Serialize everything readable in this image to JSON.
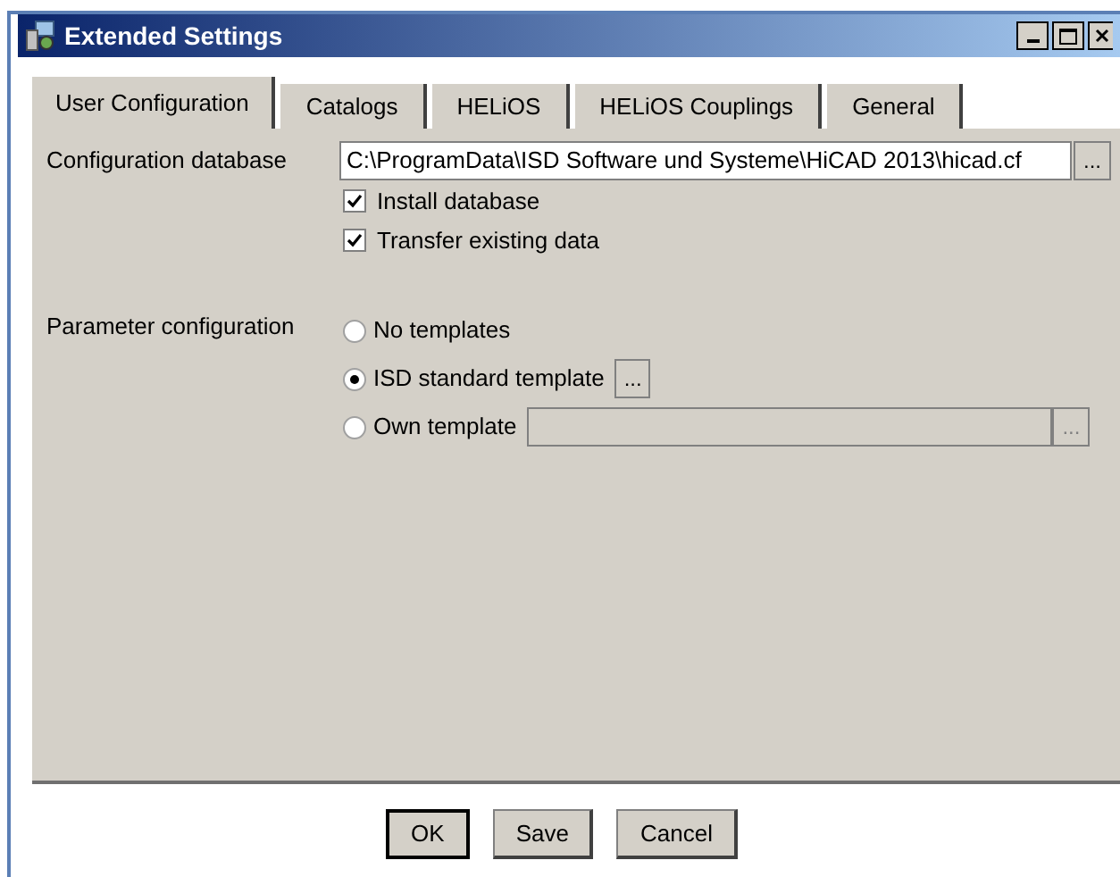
{
  "window": {
    "title": "Extended Settings"
  },
  "tabs": [
    {
      "label": "User Configuration",
      "selected": true
    },
    {
      "label": "Catalogs",
      "selected": false
    },
    {
      "label": "HELiOS",
      "selected": false
    },
    {
      "label": "HELiOS Couplings",
      "selected": false
    },
    {
      "label": "General",
      "selected": false
    }
  ],
  "configuration_database": {
    "label": "Configuration database",
    "value": "C:\\ProgramData\\ISD Software und Systeme\\HiCAD 2013\\hicad.cf",
    "browse": "...",
    "options": [
      {
        "label": "Install database",
        "checked": true
      },
      {
        "label": "Transfer existing data",
        "checked": true
      }
    ]
  },
  "parameter_configuration": {
    "label": "Parameter configuration",
    "options": [
      {
        "label": "No templates",
        "selected": false,
        "kind": "plain"
      },
      {
        "label": "ISD standard template",
        "selected": true,
        "kind": "button",
        "browse": "..."
      },
      {
        "label": "Own template",
        "selected": false,
        "kind": "field",
        "browse": "...",
        "disabled": true
      }
    ]
  },
  "buttons": [
    {
      "label": "OK",
      "default": true
    },
    {
      "label": "Save",
      "default": false
    },
    {
      "label": "Cancel",
      "default": false
    }
  ]
}
